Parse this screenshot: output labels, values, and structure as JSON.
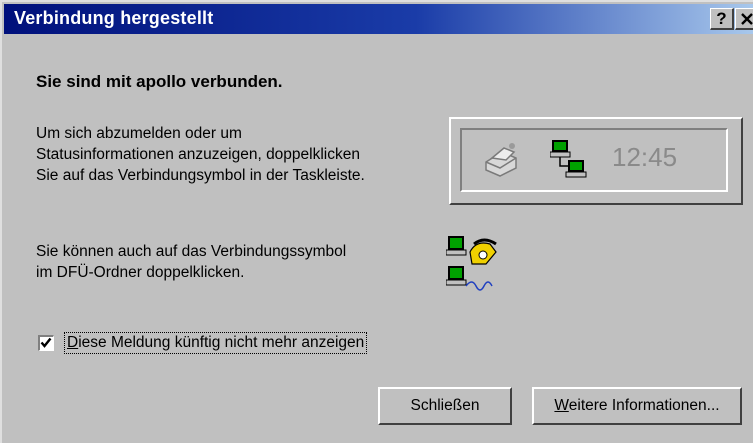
{
  "window": {
    "title": "Verbindung hergestellt",
    "help_button": "?",
    "close_button": "✕"
  },
  "content": {
    "heading": "Sie sind mit apollo verbunden.",
    "paragraph1": [
      "Um sich abzumelden oder um",
      "Statusinformationen anzuzeigen, doppelklicken",
      "Sie auf das Verbindungsymbol in der Taskleiste."
    ],
    "paragraph2": [
      "Sie können auch auf das Verbindungssymbol",
      "im DFÜ-Ordner doppelklicken."
    ]
  },
  "taskbar_preview": {
    "clock": "12:45",
    "icons": [
      "printer-icon",
      "network-connection-icon"
    ]
  },
  "dfu_icon": "dial-up-connection-icon",
  "checkbox": {
    "checked": true,
    "label": "Diese Meldung künftig nicht mehr anzeigen",
    "label_accesskey_first": "D",
    "label_rest": "iese Meldung künftig nicht mehr anzeigen"
  },
  "buttons": {
    "close_label": "Schließen",
    "more_info_prefix": "W",
    "more_info_rest": "eitere Informationen..."
  },
  "colors": {
    "title_gradient_start": "#00107b",
    "title_gradient_end": "#a8c8ec",
    "dialog_bg": "#c0c0c0"
  }
}
